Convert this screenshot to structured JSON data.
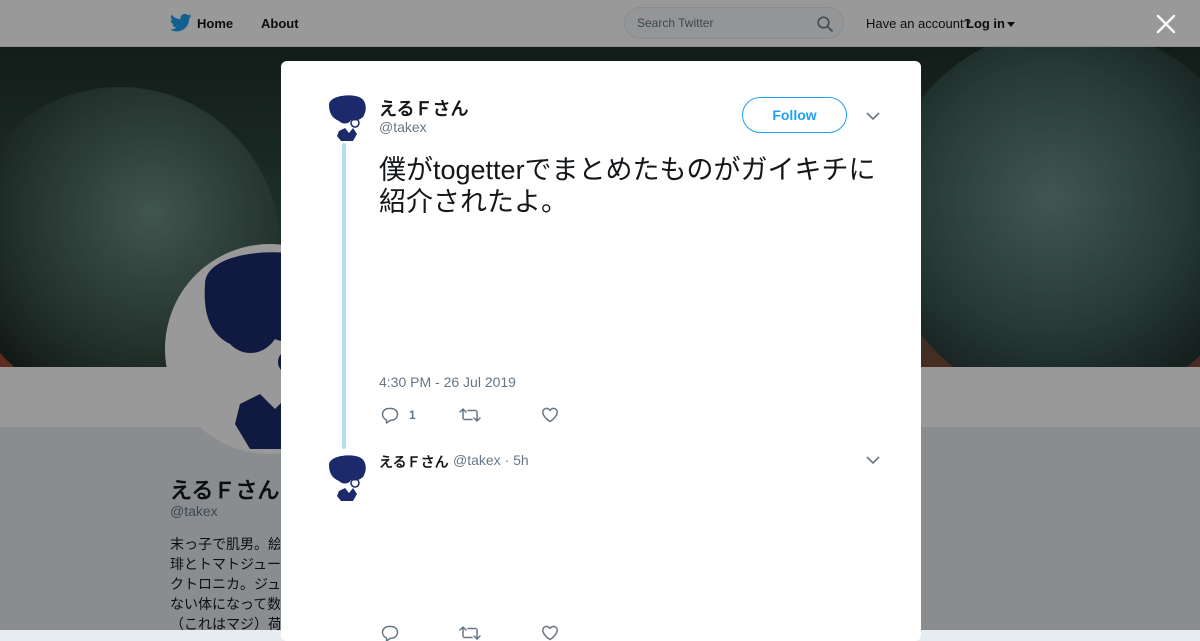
{
  "nav": {
    "home_label": "Home",
    "about_label": "About",
    "search_placeholder": "Search Twitter",
    "have_account": "Have an account?",
    "login_label": "Log in"
  },
  "profile": {
    "name": "えるＦさん",
    "handle": "@takex",
    "bio": "末っ子で肌男。絵\n琲とトマトジュー\nクトロニカ。ジュ\nない体になって数\n（これはマジ）荷"
  },
  "tweet": {
    "author_name": "えるＦさん",
    "author_handle": "@takex",
    "follow_label": "Follow",
    "text": "僕がtogetterでまとめたものがガイキチに紹介されたよ。",
    "timestamp": "4:30 PM - 26 Jul 2019",
    "reply_count": "1",
    "retweet_count": "",
    "like_count": ""
  },
  "reply": {
    "author_name": "えるＦさん",
    "author_handle": "@takex",
    "time": "· 5h"
  },
  "colors": {
    "brand_blue": "#1da1f2",
    "avatar_navy": "#1c2a6b",
    "thread_line": "#b4dcf5",
    "secondary_text": "#657786"
  },
  "icons": [
    "twitter-bird-icon",
    "search-icon",
    "caret-down-icon",
    "close-icon",
    "chevron-down-icon",
    "reply-icon",
    "retweet-icon",
    "heart-icon"
  ]
}
